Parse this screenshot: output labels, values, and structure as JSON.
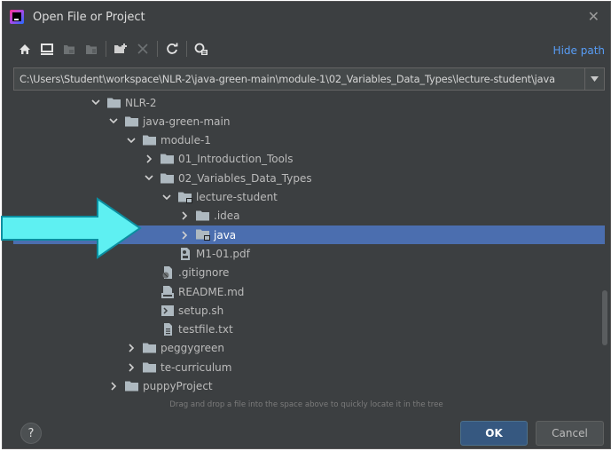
{
  "window": {
    "title": "Open File or Project"
  },
  "toolbar": {
    "icons": [
      "home-icon",
      "desktop-icon",
      "project-folder-icon",
      "module-folder-icon",
      "new-folder-icon",
      "delete-icon",
      "refresh-icon",
      "show-hidden-icon"
    ],
    "hide_path_label": "Hide path"
  },
  "path": {
    "value": "C:\\Users\\Student\\workspace\\NLR-2\\java-green-main\\module-1\\02_Variables_Data_Types\\lecture-student\\java"
  },
  "tree": [
    {
      "label": "NLR-2",
      "depth": 0,
      "chevron": "down",
      "icon": "folder"
    },
    {
      "label": "java-green-main",
      "depth": 1,
      "chevron": "down",
      "icon": "folder"
    },
    {
      "label": "module-1",
      "depth": 2,
      "chevron": "down",
      "icon": "folder"
    },
    {
      "label": "01_Introduction_Tools",
      "depth": 3,
      "chevron": "right",
      "icon": "folder"
    },
    {
      "label": "02_Variables_Data_Types",
      "depth": 3,
      "chevron": "down",
      "icon": "folder"
    },
    {
      "label": "lecture-student",
      "depth": 4,
      "chevron": "down",
      "icon": "module-folder"
    },
    {
      "label": ".idea",
      "depth": 5,
      "chevron": "right",
      "icon": "folder"
    },
    {
      "label": "java",
      "depth": 5,
      "chevron": "right",
      "icon": "module-folder",
      "selected": true
    },
    {
      "label": "M1-01.pdf",
      "depth": 4,
      "chevron": "none",
      "icon": "pdf-file"
    },
    {
      "label": ".gitignore",
      "depth": 3,
      "chevron": "none",
      "icon": "gitignore-file"
    },
    {
      "label": "README.md",
      "depth": 3,
      "chevron": "none",
      "icon": "markdown-file"
    },
    {
      "label": "setup.sh",
      "depth": 3,
      "chevron": "none",
      "icon": "shell-file"
    },
    {
      "label": "testfile.txt",
      "depth": 3,
      "chevron": "none",
      "icon": "text-file"
    },
    {
      "label": "peggygreen",
      "depth": 2,
      "chevron": "right",
      "icon": "folder"
    },
    {
      "label": "te-curriculum",
      "depth": 2,
      "chevron": "right",
      "icon": "folder"
    },
    {
      "label": "puppyProject",
      "depth": 1,
      "chevron": "right",
      "icon": "folder"
    }
  ],
  "footer": {
    "hint": "Drag and drop a file into the space above to quickly locate it in the tree",
    "help_label": "?",
    "ok_label": "OK",
    "cancel_label": "Cancel"
  },
  "colors": {
    "background": "#3c3f41",
    "selection": "#4b6eaf",
    "link": "#589df6",
    "ok_button": "#365880",
    "annotation_arrow": "#5ef0f2"
  }
}
